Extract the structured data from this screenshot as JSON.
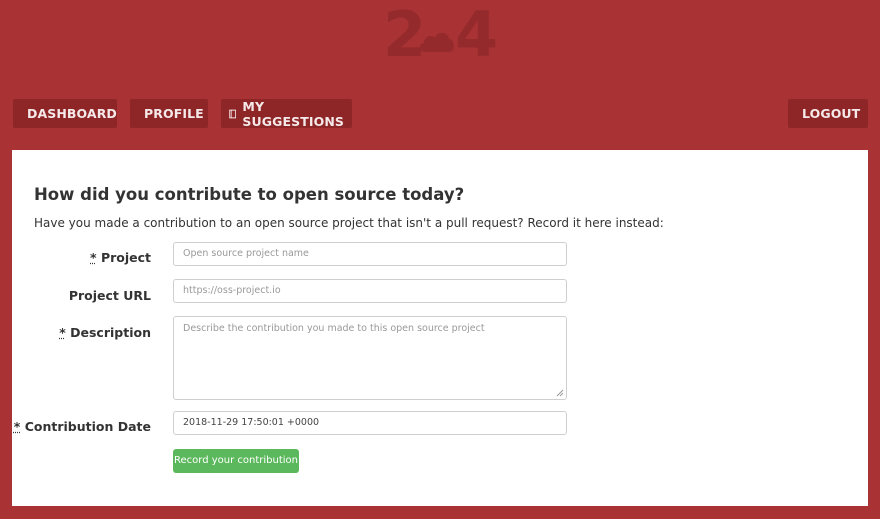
{
  "logo": {
    "left_digit": "2",
    "right_digit": "4",
    "icon": "cloud-icon"
  },
  "nav": {
    "dashboard": {
      "label": "DASHBOARD",
      "icon": "dashboard-gauge-icon"
    },
    "profile": {
      "label": "PROFILE",
      "icon": "user-icon"
    },
    "suggestions": {
      "label": "MY SUGGESTIONS",
      "icon": "book-icon"
    },
    "logout": {
      "label": "LOGOUT",
      "icon": "sign-out-icon"
    }
  },
  "form": {
    "heading": "How did you contribute to open source today?",
    "intro": "Have you made a contribution to an open source project that isn't a pull request? Record it here instead:",
    "project": {
      "required_mark": "*",
      "label": "Project",
      "placeholder": "Open source project name",
      "value": ""
    },
    "url": {
      "label": "Project URL",
      "placeholder": "https://oss-project.io",
      "value": ""
    },
    "description": {
      "required_mark": "*",
      "label": "Description",
      "placeholder": "Describe the contribution you made to this open source project",
      "value": ""
    },
    "date": {
      "required_mark": "*",
      "label": "Contribution Date",
      "value": "2018-11-29 17:50:01 +0000"
    },
    "submit_label": "Record your contribution"
  },
  "colors": {
    "background": "#a83234",
    "nav_button": "#8e2628",
    "submit": "#5cb85c"
  }
}
